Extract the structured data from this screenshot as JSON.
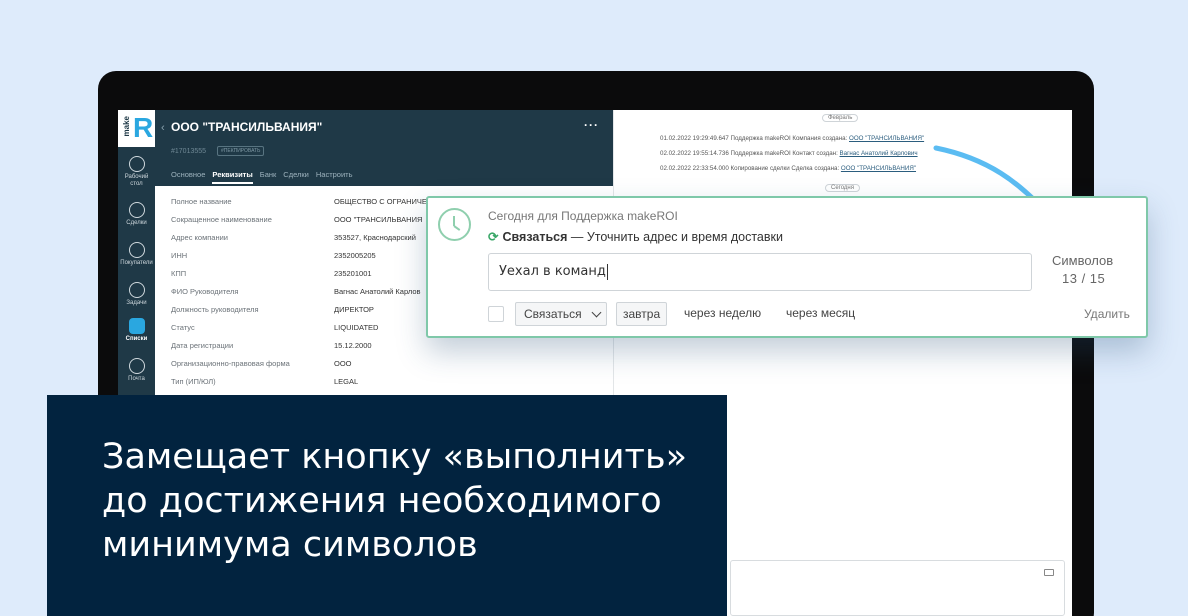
{
  "sidebar": {
    "logo_word": "make",
    "logo_letter": "R",
    "items": [
      {
        "label": "Рабочий стол",
        "icon": "dashboard-icon"
      },
      {
        "label": "Сделки",
        "icon": "dollar-icon"
      },
      {
        "label": "Покупатели",
        "icon": "customers-icon"
      },
      {
        "label": "Задачи",
        "icon": "tasks-check-icon"
      },
      {
        "label": "Списки",
        "icon": "lists-icon"
      },
      {
        "label": "Почта",
        "icon": "mail-icon"
      }
    ]
  },
  "header": {
    "back": "‹",
    "title": "ООО \"ТРАНСИЛЬВАНИЯ\"",
    "more": "···",
    "card_id": "#17013555",
    "copy_label": "#ПЕКПИРОВАТЬ",
    "tabs": [
      "Основное",
      "Реквизиты",
      "Банк",
      "Сделки",
      "Настроить"
    ],
    "active_tab": "Реквизиты"
  },
  "details": [
    {
      "label": "Полное название",
      "value": "ОБЩЕСТВО С ОГРАНИЧЕ"
    },
    {
      "label": "Сокращенное наименование",
      "value": "ООО \"ТРАНСИЛЬВАНИЯ"
    },
    {
      "label": "Адрес компании",
      "value": "353527, Краснодарский"
    },
    {
      "label": "ИНН",
      "value": "2352005205"
    },
    {
      "label": "КПП",
      "value": "235201001"
    },
    {
      "label": "ФИО Руководителя",
      "value": "Вагнас Анатолий Карлов"
    },
    {
      "label": "Должность руководителя",
      "value": "ДИРЕКТОР"
    },
    {
      "label": "Статус",
      "value": "LIQUIDATED"
    },
    {
      "label": "Дата регистрации",
      "value": "15.12.2000"
    },
    {
      "label": "Организационно-правовая форма",
      "value": "ООО"
    },
    {
      "label": "Тип (ИП/ЮЛ)",
      "value": "LEGAL"
    }
  ],
  "feed": {
    "month_label": "Февраль",
    "today_label": "Сегодня",
    "events": [
      {
        "text": "01.02.2022 19:29:49.647 Поддержка makeROI Компания создана: ",
        "link": "ООО \"ТРАНСИЛЬВАНИЯ\""
      },
      {
        "text": "02.02.2022 19:55:14.736 Поддержка makeROI Контакт создан: ",
        "link": "Вагнас Анатолий Карлович"
      },
      {
        "text": "02.02.2022 22:33:54.000 Копирование сделки Сделка создана: ",
        "link": "ООО \"ТРАНСИЛЬВАНИЯ\""
      }
    ]
  },
  "task": {
    "meta": "Сегодня для Поддержка makeROI",
    "action": "Связаться",
    "description": " — Уточнить адрес и время доставки",
    "input_value": "Уехал в команд",
    "counter_label": "Символов",
    "counter_value": "13 / 15",
    "type_select": "Связаться",
    "date_button": "завтра",
    "quick_links": [
      "через неделю",
      "через месяц"
    ],
    "delete_label": "Удалить"
  },
  "caption": {
    "text": "Замещает кнопку «выполнить» до достижения необходимого минимума символов"
  },
  "colors": {
    "page_bg": "#deebfb",
    "dark_panel": "#1f3947",
    "caption_bg": "#02233f",
    "accent_blue": "#2aa7e0",
    "task_border": "#7fc8a9",
    "arrow": "#5bbcf2"
  }
}
